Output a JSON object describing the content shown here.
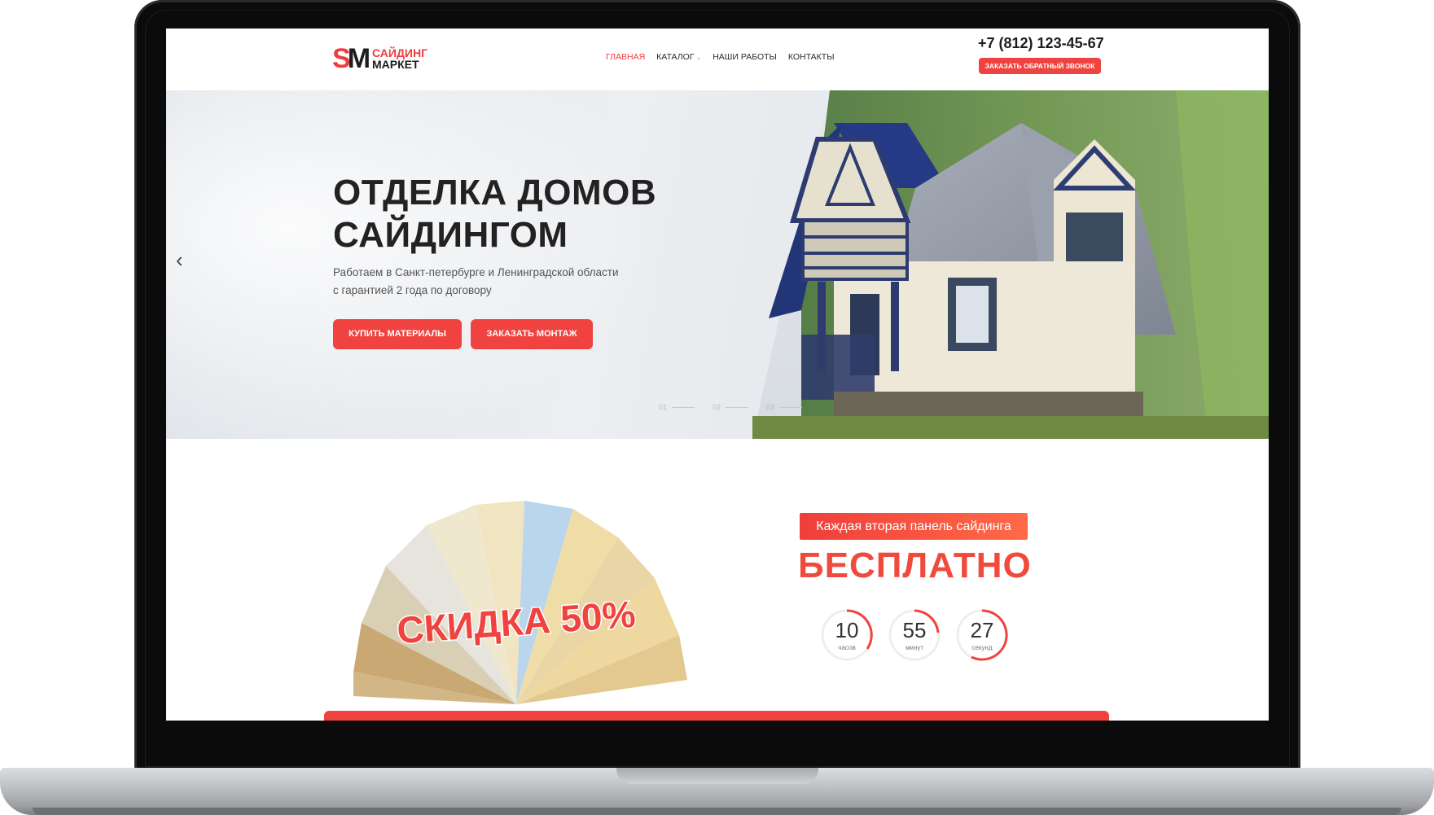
{
  "header": {
    "logo_mark": "SM",
    "logo_line1": "САЙДИНГ",
    "logo_line2": "МАРКЕТ",
    "nav": [
      "ГЛАВНАЯ",
      "КАТАЛОГ",
      "НАШИ РАБОТЫ",
      "КОНТАКТЫ"
    ],
    "phone": "+7 (812) 123-45-67",
    "callback_label": "ЗАКАЗАТЬ ОБРАТНЫЙ ЗВОНОК"
  },
  "hero": {
    "title_line1": "ОТДЕЛКА ДОМОВ",
    "title_line2": "САЙДИНГОМ",
    "subtitle_line1": "Работаем в Санкт-петербурге и Ленинградской области",
    "subtitle_line2": "с гарантией 2 года по договору",
    "btn_buy": "КУПИТЬ МАТЕРИАЛЫ",
    "btn_install": "ЗАКАЗАТЬ МОНТАЖ",
    "slides": [
      "01",
      "02",
      "03"
    ]
  },
  "promo": {
    "discount": "СКИДКА 50%",
    "badge": "Каждая вторая панель сайдинга",
    "free": "БЕСПЛАТНО",
    "timer": [
      {
        "value": "10",
        "label": "часов"
      },
      {
        "value": "55",
        "label": "минут"
      },
      {
        "value": "27",
        "label": "секунд"
      }
    ]
  },
  "colors": {
    "accent": "#f0433f",
    "text": "#222222"
  }
}
